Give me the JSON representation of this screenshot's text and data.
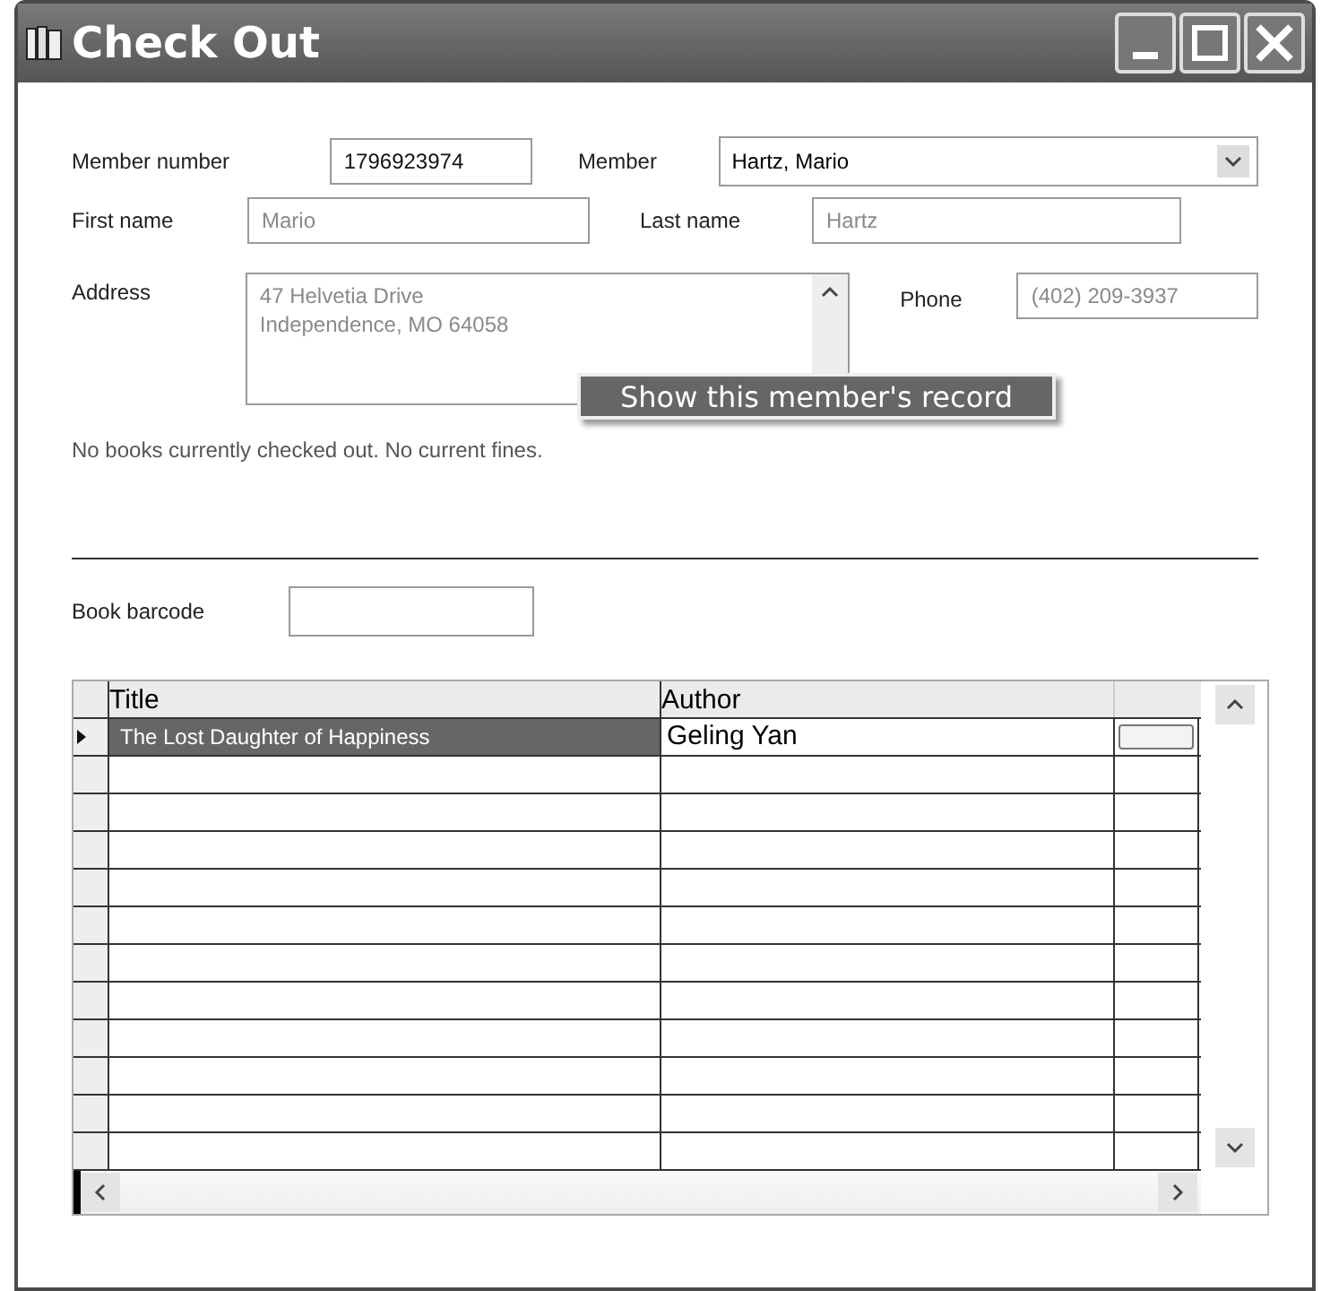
{
  "window": {
    "title": "Check Out"
  },
  "member_number": {
    "label": "Member number",
    "value": "1796923974"
  },
  "member": {
    "label": "Member",
    "value": "Hartz, Mario"
  },
  "first_name": {
    "label": "First name",
    "value": "Mario"
  },
  "last_name": {
    "label": "Last name",
    "value": "Hartz"
  },
  "address": {
    "label": "Address",
    "lines": [
      "47 Helvetia Drive",
      "Independence, MO 64058"
    ]
  },
  "phone": {
    "label": "Phone",
    "value": "(402) 209-3937"
  },
  "context_menu": {
    "items": [
      "Show this member's record"
    ]
  },
  "status": "No books currently checked out. No current fines.",
  "book_barcode": {
    "label": "Book barcode"
  },
  "table": {
    "columns": [
      "Title",
      "Author"
    ],
    "rows": [
      {
        "title": "The Lost Daughter of Happiness",
        "author": "Geling Yan",
        "selected": true
      }
    ]
  }
}
